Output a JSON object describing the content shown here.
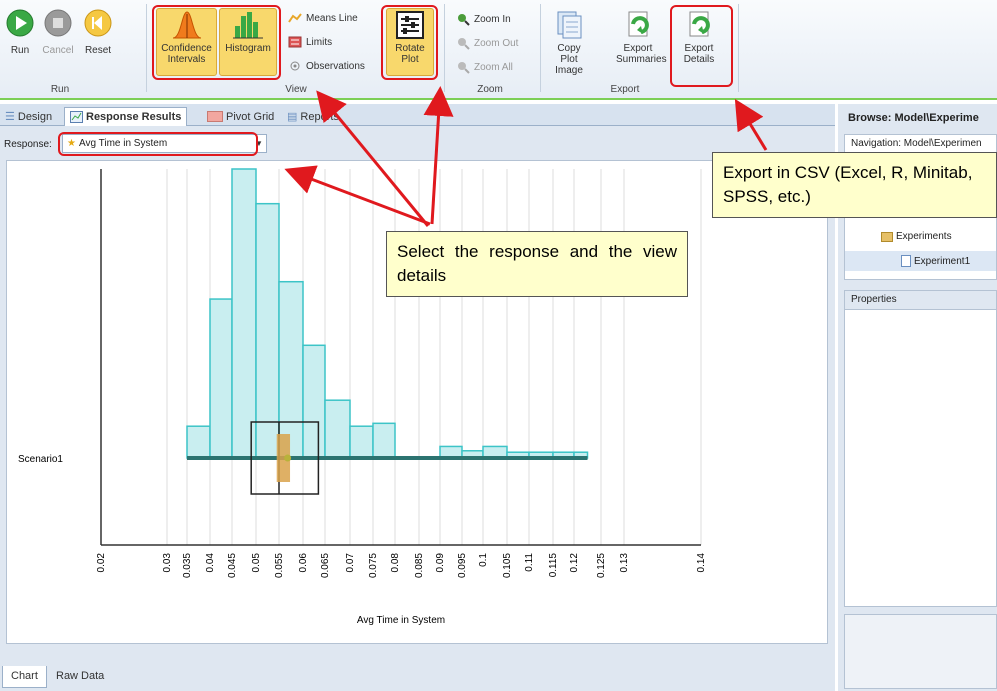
{
  "ribbon": {
    "run_group": {
      "label": "Run",
      "buttons": [
        {
          "label": "Run"
        },
        {
          "label": "Cancel"
        },
        {
          "label": "Reset"
        }
      ]
    },
    "view_group": {
      "label": "View",
      "confidence_intervals": "Confidence Intervals",
      "histogram": "Histogram",
      "means_line": "Means Line",
      "limits": "Limits",
      "observations": "Observations",
      "rotate_plot": "Rotate Plot"
    },
    "zoom_group": {
      "label": "Zoom",
      "zoom_in": "Zoom In",
      "zoom_out": "Zoom Out",
      "zoom_all": "Zoom All"
    },
    "export_group": {
      "label": "Export",
      "copy_plot_image": "Copy Plot Image",
      "export_summaries": "Export Summaries",
      "export_details": "Export Details"
    }
  },
  "tabs": [
    "Design",
    "Response Results",
    "Pivot Grid",
    "Reports"
  ],
  "response": {
    "label": "Response:",
    "value": "Avg Time in System"
  },
  "bottom_tabs": [
    "Chart",
    "Raw Data"
  ],
  "right_panel": {
    "browse_title": "Browse: Model\\Experime",
    "navigation": "Navigation: Model\\Experimen",
    "tree": [
      "Experiments",
      "Experiment1"
    ],
    "properties": "Properties"
  },
  "callouts": {
    "select": "Select the response and the view details",
    "export": "Export in CSV (Excel, R, Minitab, SPSS, etc.)"
  },
  "chart_data": {
    "type": "bar",
    "xlabel": "Avg Time in System",
    "category_label": "Scenario1",
    "xlim": [
      0.02,
      0.14
    ],
    "xticks": [
      "0.02",
      "0.03",
      "0.035",
      "0.04",
      "0.045",
      "0.05",
      "0.055",
      "0.06",
      "0.065",
      "0.07",
      "0.075",
      "0.08",
      "0.085",
      "0.09",
      "0.095",
      "0.1",
      "0.105",
      "0.11",
      "0.115",
      "0.12",
      "0.125",
      "0.13",
      "0.14"
    ],
    "histogram": {
      "bin_edges": [
        0.035,
        0.04,
        0.045,
        0.05,
        0.055,
        0.06,
        0.065,
        0.07,
        0.075,
        0.08,
        0.085,
        0.09,
        0.095,
        0.1,
        0.105,
        0.11,
        0.115,
        0.12,
        0.1225
      ],
      "heights": [
        0.11,
        0.55,
        1.0,
        0.88,
        0.61,
        0.39,
        0.2,
        0.11,
        0.12,
        0,
        0,
        0.04,
        0.025,
        0.04,
        0.02,
        0.02,
        0.02,
        0.02
      ]
    },
    "range": [
      0.035,
      0.1225
    ],
    "box": {
      "q1": 0.049,
      "median": 0.055,
      "q3": 0.0635
    },
    "mean": 0.0568,
    "confidence_interval": [
      0.0545,
      0.0573
    ]
  },
  "colors": {
    "hist_fill": "#c9eef0",
    "hist_stroke": "#3cc4c7",
    "highlight": "#e0191e",
    "accent_green": "#7ccf55",
    "callout_bg": "#ffffcc"
  }
}
